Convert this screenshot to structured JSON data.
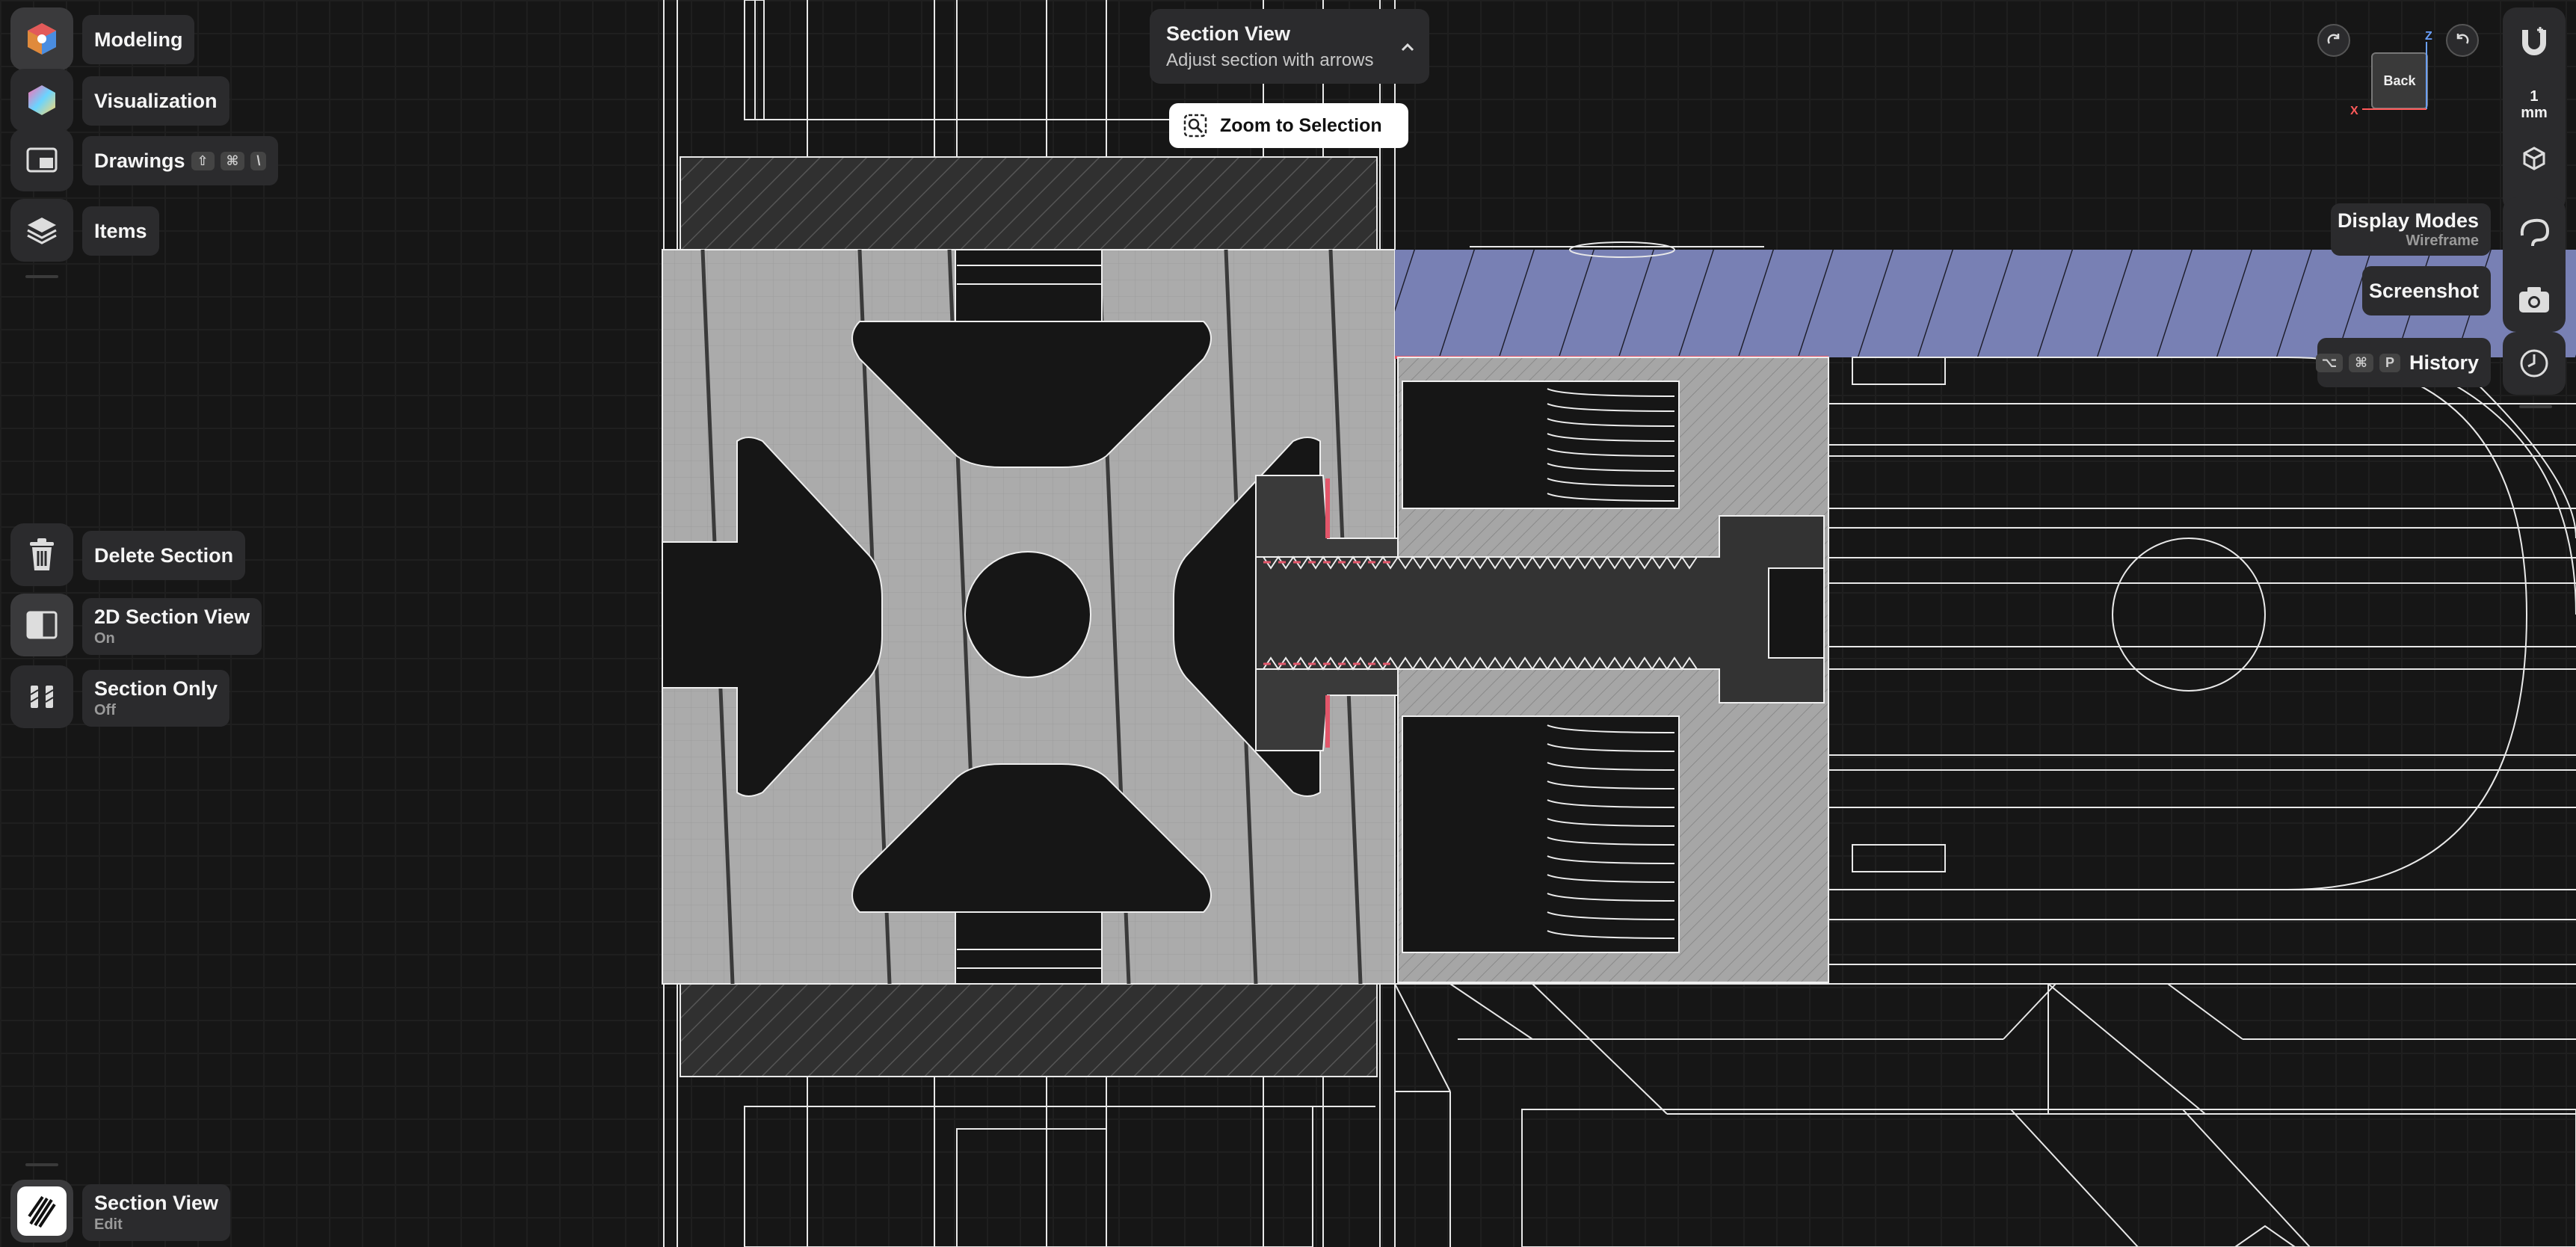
{
  "left_toolbar": {
    "modeling": {
      "label": "Modeling"
    },
    "visualization": {
      "label": "Visualization"
    },
    "drawings": {
      "label": "Drawings",
      "shortcut": [
        "⇧",
        "⌘",
        "\\"
      ]
    },
    "items": {
      "label": "Items"
    },
    "delete_section": {
      "label": "Delete Section"
    },
    "section_2d": {
      "label": "2D Section View",
      "state": "On"
    },
    "section_only": {
      "label": "Section Only",
      "state": "Off"
    },
    "section_view": {
      "label": "Section View",
      "state": "Edit"
    }
  },
  "popup": {
    "title": "Section View",
    "subtitle": "Adjust section with arrows",
    "zoom_label": "Zoom to Selection"
  },
  "view_cube": {
    "face": "Back",
    "axis_z": "Z",
    "axis_x": "X"
  },
  "right_toolbar": {
    "units": {
      "value": "1",
      "unit": "mm"
    },
    "display_modes": {
      "label": "Display Modes",
      "value": "Wireframe"
    },
    "screenshot": {
      "label": "Screenshot"
    },
    "history": {
      "label": "History",
      "shortcut": [
        "⌥",
        "⌘",
        "P"
      ]
    }
  },
  "colors": {
    "background": "#161616",
    "panel": "#2b2b2d",
    "section_fill": "#a9a9a9",
    "blue_section": "#7b84b8",
    "cut_edge": "#e2566a"
  }
}
